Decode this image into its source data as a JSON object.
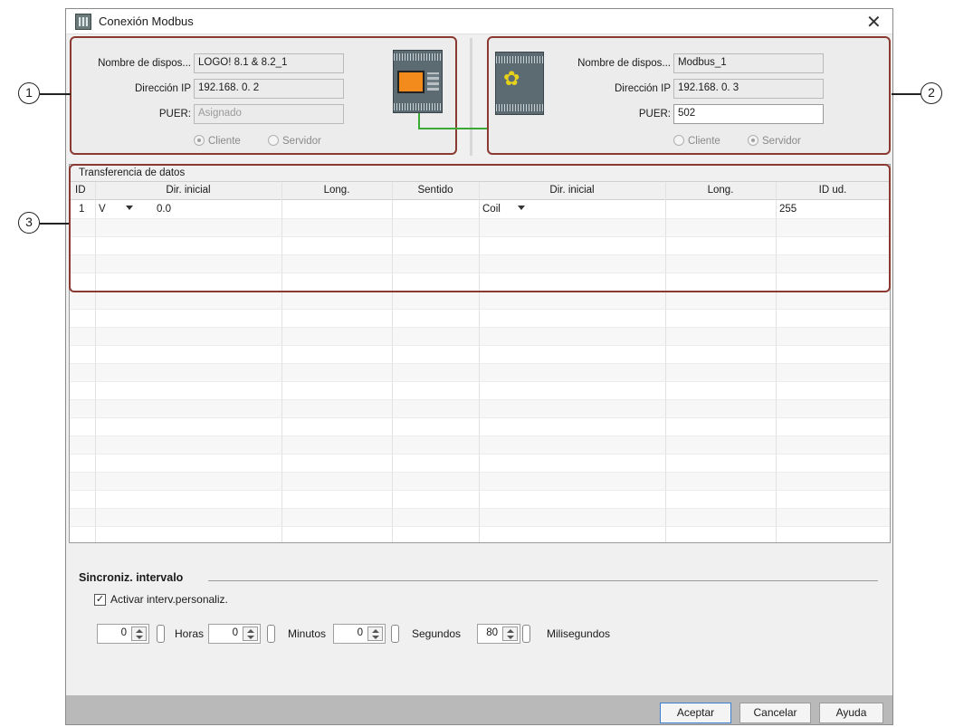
{
  "window": {
    "title": "Conexión Modbus"
  },
  "callouts": [
    "1",
    "2",
    "3"
  ],
  "local_device": {
    "name_label": "Nombre de dispos...",
    "name_value": "LOGO! 8.1 & 8.2_1",
    "ip_label": "Dirección IP",
    "ip_value": "192.168.  0.  2",
    "port_label": "PUER:",
    "port_value": "Asignado",
    "role_client": "Cliente",
    "role_server": "Servidor",
    "selected_role": "Cliente"
  },
  "remote_device": {
    "name_label": "Nombre de dispos...",
    "name_value": "Modbus_1",
    "ip_label": "Dirección IP",
    "ip_value": "192.168.  0.  3",
    "port_label": "PUER:",
    "port_value": "502",
    "role_client": "Cliente",
    "role_server": "Servidor",
    "selected_role": "Servidor"
  },
  "data_transfer": {
    "title": "Transferencia de datos",
    "columns": [
      "ID",
      "Dir. inicial",
      "Long.",
      "Sentido",
      "Dir. inicial",
      "Long.",
      "ID ud."
    ],
    "rows": [
      {
        "id": "1",
        "local_area": "V",
        "local_address": "0.0",
        "length": "",
        "direction": "",
        "remote_area": "Coil",
        "remote_length": "",
        "unit_id": "255"
      }
    ]
  },
  "sync": {
    "title": "Sincroniz. intervalo",
    "checkbox_label": "Activar interv.personaliz.",
    "checked": true,
    "hours": {
      "value": "0",
      "unit": "Horas"
    },
    "minutes": {
      "value": "0",
      "unit": "Minutos"
    },
    "seconds": {
      "value": "0",
      "unit": "Segundos"
    },
    "milliseconds": {
      "value": "80",
      "unit": "Milisegundos"
    }
  },
  "buttons": {
    "ok": "Aceptar",
    "cancel": "Cancelar",
    "help": "Ayuda"
  },
  "colors": {
    "highlight_border": "#8b3a32",
    "network_line": "#3aaa35",
    "primary_button_border": "#3c7fd1"
  }
}
